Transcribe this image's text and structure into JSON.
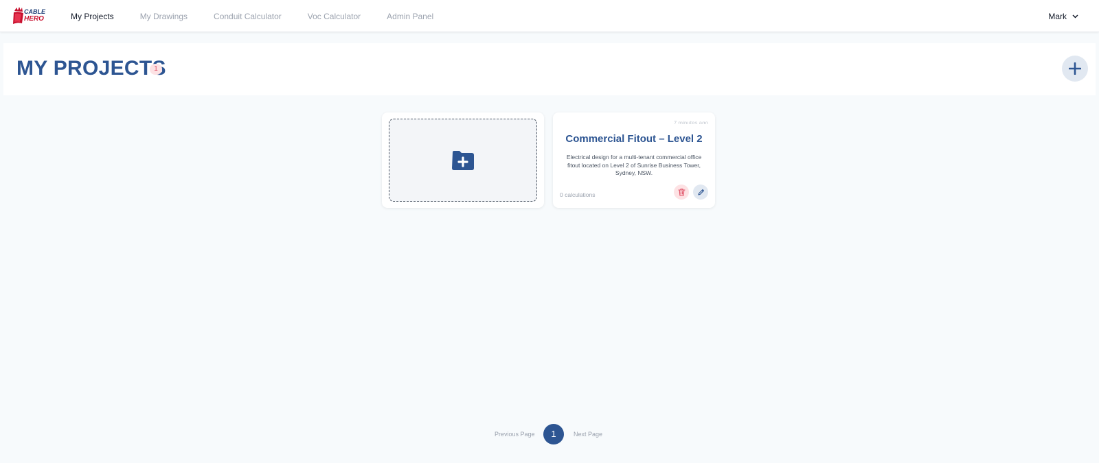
{
  "colors": {
    "primary": "#2d5592",
    "badge_bg": "#fde2e4",
    "badge_text": "#e05267",
    "background": "#f7fafc"
  },
  "logo": {
    "text_line1": "CABLE",
    "text_line2": "HERO"
  },
  "nav": {
    "items": [
      {
        "label": "My Projects",
        "active": true
      },
      {
        "label": "My Drawings"
      },
      {
        "label": "Conduit Calculator"
      },
      {
        "label": "Voc Calculator"
      },
      {
        "label": "Admin Panel"
      }
    ],
    "user": {
      "name": "Mark",
      "icon": "chevron-down-icon"
    }
  },
  "header": {
    "title": "MY PROJECTS",
    "count": "1",
    "add_icon": "plus-icon"
  },
  "new_project_card": {
    "icon": "folder-plus-icon"
  },
  "projects": [
    {
      "time": "7 minutes ago",
      "title": "Commercial Fitout – Level 2",
      "description": "Electrical design for a multi-tenant commercial office fitout located on Level 2 of Sunrise Business Tower, Sydney, NSW.",
      "calculations": "0 calculations",
      "delete_icon": "trash-icon",
      "edit_icon": "pencil-icon"
    }
  ],
  "pagination": {
    "previous": "Previous Page",
    "current": "1",
    "next": "Next Page"
  }
}
